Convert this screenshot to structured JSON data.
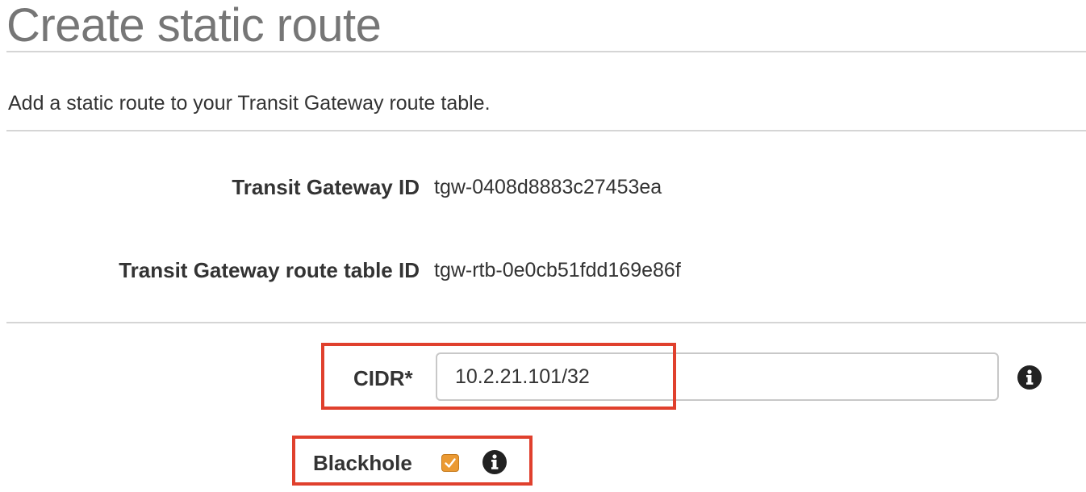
{
  "page": {
    "title": "Create static route",
    "description": "Add a static route to your Transit Gateway route table."
  },
  "details": {
    "transit_gateway_id_label": "Transit Gateway ID",
    "transit_gateway_id_value": "tgw-0408d8883c27453ea",
    "route_table_id_label": "Transit Gateway route table ID",
    "route_table_id_value": "tgw-rtb-0e0cb51fdd169e86f"
  },
  "form": {
    "cidr_label": "CIDR*",
    "cidr_value": "10.2.21.101/32",
    "blackhole_label": "Blackhole",
    "blackhole_checked": true
  },
  "icons": {
    "info": "info-icon",
    "check": "check-icon"
  },
  "colors": {
    "title": "#767676",
    "checkbox": "#eb9a33",
    "highlight": "#e0402d",
    "info_icon": "#222222"
  }
}
